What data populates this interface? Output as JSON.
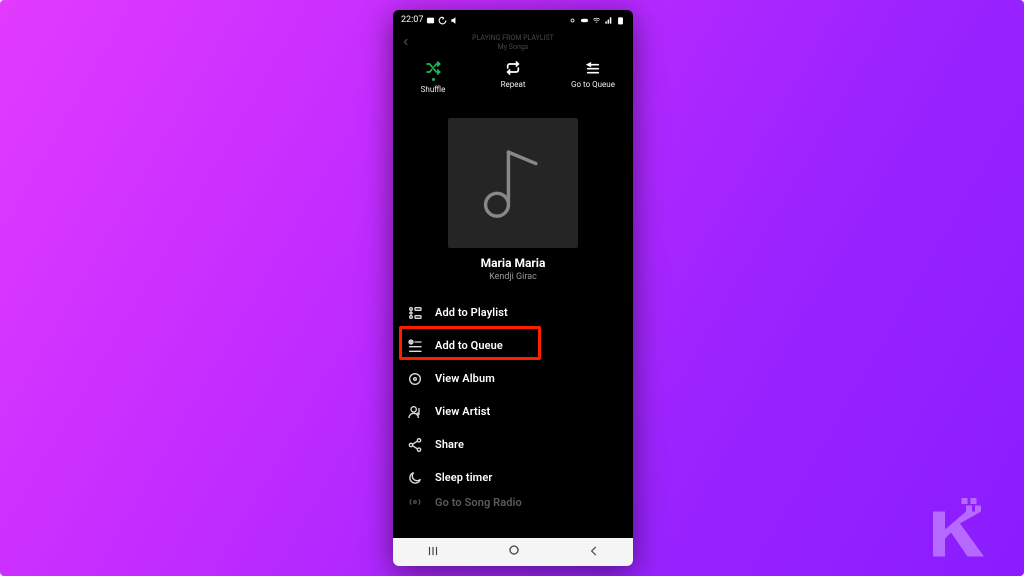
{
  "status": {
    "time": "22:07"
  },
  "header": {
    "context_line1": "PLAYING FROM PLAYLIST",
    "context_line2": "My Songs"
  },
  "top_actions": {
    "shuffle": "Shuffle",
    "repeat": "Repeat",
    "queue": "Go to Queue"
  },
  "track": {
    "title": "Maria Maria",
    "artist": "Kendji Girac"
  },
  "menu": {
    "add_playlist": "Add to Playlist",
    "add_queue": "Add to Queue",
    "view_album": "View Album",
    "view_artist": "View Artist",
    "share": "Share",
    "sleep_timer": "Sleep timer",
    "song_radio": "Go to Song Radio"
  }
}
